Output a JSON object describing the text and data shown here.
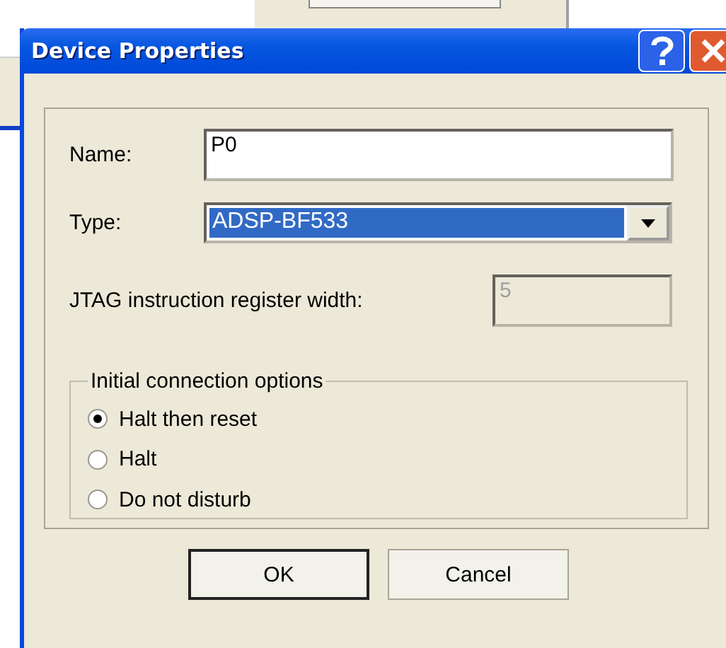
{
  "window": {
    "title": "Device Properties"
  },
  "fields": [
    {
      "kind": "text",
      "label": "Name:",
      "value": "P0",
      "disabled": false
    },
    {
      "kind": "dropdown",
      "label": "Type:",
      "value": "ADSP-BF533",
      "disabled": false
    },
    {
      "kind": "text",
      "label": "JTAG instruction register width:",
      "value": "5",
      "disabled": true
    }
  ],
  "group": {
    "title": "Initial connection options",
    "options": [
      {
        "label": "Halt then reset",
        "selected": true
      },
      {
        "label": "Halt",
        "selected": false
      },
      {
        "label": "Do not disturb",
        "selected": false
      }
    ]
  },
  "buttons": [
    {
      "label": "OK",
      "default": true
    },
    {
      "label": "Cancel",
      "default": false
    }
  ]
}
